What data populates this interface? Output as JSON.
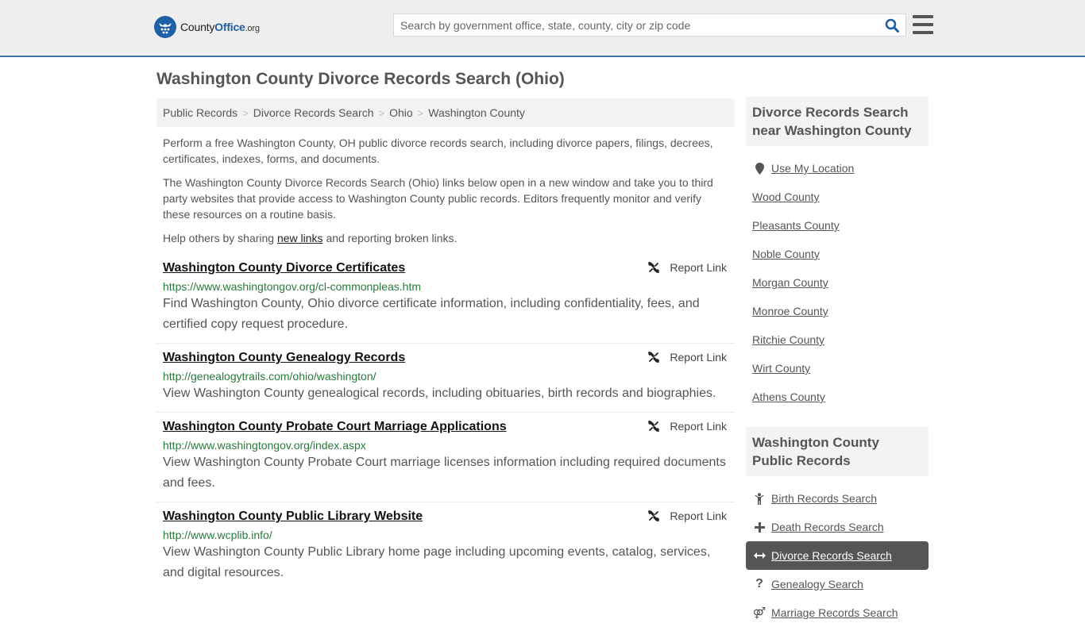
{
  "header": {
    "logo": {
      "brand_part1": "County",
      "brand_part2": "Office",
      "brand_suffix": ".org"
    },
    "search": {
      "placeholder": "Search by government office, state, county, city or zip code",
      "value": ""
    },
    "search_icon": "search-icon",
    "menu_icon": "hamburger-menu-icon",
    "colors": {
      "accent": "#1f5fa6",
      "header_border": "#3f75a5"
    }
  },
  "page": {
    "title": "Washington County Divorce Records Search (Ohio)"
  },
  "breadcrumb": [
    {
      "label": "Public Records"
    },
    {
      "label": "Divorce Records Search"
    },
    {
      "label": "Ohio"
    },
    {
      "label": "Washington County"
    }
  ],
  "breadcrumb_separator": ">",
  "intro": {
    "p1": "Perform a free Washington County, OH public divorce records search, including divorce papers, filings, decrees, certificates, indexes, forms, and documents.",
    "p2": "The Washington County Divorce Records Search (Ohio) links below open in a new window and take you to third party websites that provide access to Washington County public records. Editors frequently monitor and verify these resources on a routine basis.",
    "p3_before": "Help others by sharing ",
    "p3_link": "new links",
    "p3_after": " and reporting broken links."
  },
  "results": [
    {
      "title": "Washington County Divorce Certificates",
      "url": "https://www.washingtongov.org/cl-commonpleas.htm",
      "description": "Find Washington County, Ohio divorce certificate information, including confidentiality, fees, and certified copy request procedure.",
      "report_label": "Report Link"
    },
    {
      "title": "Washington County Genealogy Records",
      "url": "http://genealogytrails.com/ohio/washington/",
      "description": "View Washington County genealogical records, including obituaries, birth records and biographies.",
      "report_label": "Report Link"
    },
    {
      "title": "Washington County Probate Court Marriage Applications",
      "url": "http://www.washingtongov.org/index.aspx",
      "description": "View Washington County Probate Court marriage licenses information including required documents and fees.",
      "report_label": "Report Link"
    },
    {
      "title": "Washington County Public Library Website",
      "url": "http://www.wcplib.info/",
      "description": "View Washington County Public Library home page including upcoming events, catalog, services, and digital resources.",
      "report_label": "Report Link"
    }
  ],
  "sidebar": {
    "nearby": {
      "heading": "Divorce Records Search near Washington County",
      "use_location": "Use My Location",
      "counties": [
        "Wood County",
        "Pleasants County",
        "Noble County",
        "Morgan County",
        "Monroe County",
        "Ritchie County",
        "Wirt County",
        "Athens County"
      ]
    },
    "public_records": {
      "heading": "Washington County Public Records",
      "items": [
        {
          "label": "Birth Records Search",
          "icon": "child-icon",
          "active": false
        },
        {
          "label": "Death Records Search",
          "icon": "plus-icon",
          "active": false
        },
        {
          "label": "Divorce Records Search",
          "icon": "arrows-horizontal-icon",
          "active": true
        },
        {
          "label": "Genealogy Search",
          "icon": "question-icon",
          "active": false
        },
        {
          "label": "Marriage Records Search",
          "icon": "venus-mars-icon",
          "active": false
        }
      ]
    }
  }
}
